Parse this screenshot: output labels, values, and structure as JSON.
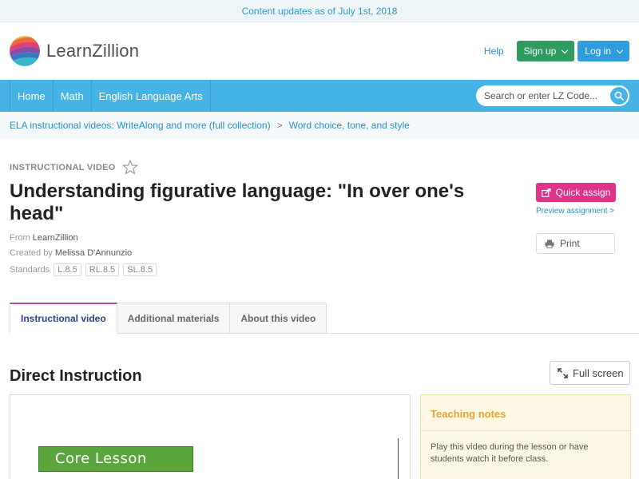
{
  "notice": "Content updates as of July 1st, 2018",
  "brand": {
    "name": "LearnZillion"
  },
  "header": {
    "help": "Help",
    "signup": "Sign up",
    "login": "Log in"
  },
  "nav": {
    "items": [
      "Home",
      "Math",
      "English Language Arts"
    ]
  },
  "search": {
    "placeholder": "Search or enter LZ Code..."
  },
  "breadcrumb": {
    "items": [
      "ELA instructional videos: WriteAlong and more (full collection)",
      "Word choice, tone, and style"
    ],
    "separator": ">"
  },
  "lesson": {
    "type": "INSTRUCTIONAL VIDEO",
    "title": "Understanding figurative language: \"In over one's head\"",
    "from_label": "From",
    "from": "LearnZillion",
    "created_label": "Created by",
    "created_by": "Melissa D'Annunzio",
    "standards_label": "Standards",
    "standards": [
      "L.8.5",
      "RL.8.5",
      "SL.8.5"
    ]
  },
  "actions": {
    "quick_assign": "Quick assign",
    "preview": "Preview assignment >",
    "print": "Print"
  },
  "tabs": [
    "Instructional video",
    "Additional materials",
    "About this video"
  ],
  "section": {
    "title": "Direct Instruction",
    "fullscreen": "Full screen"
  },
  "video": {
    "slide_label": "Core Lesson"
  },
  "teaching_notes": {
    "title": "Teaching notes",
    "text": "Play this video during the lesson or have students watch it before class."
  },
  "colors": {
    "nav_blue": "#45b3e6",
    "signup_green": "#2f9b5f",
    "login_blue": "#2f9ddc",
    "quick_assign_pink": "#e0338a",
    "active_tab_accent": "#b74aa6",
    "notes_title": "#e9a23b"
  }
}
